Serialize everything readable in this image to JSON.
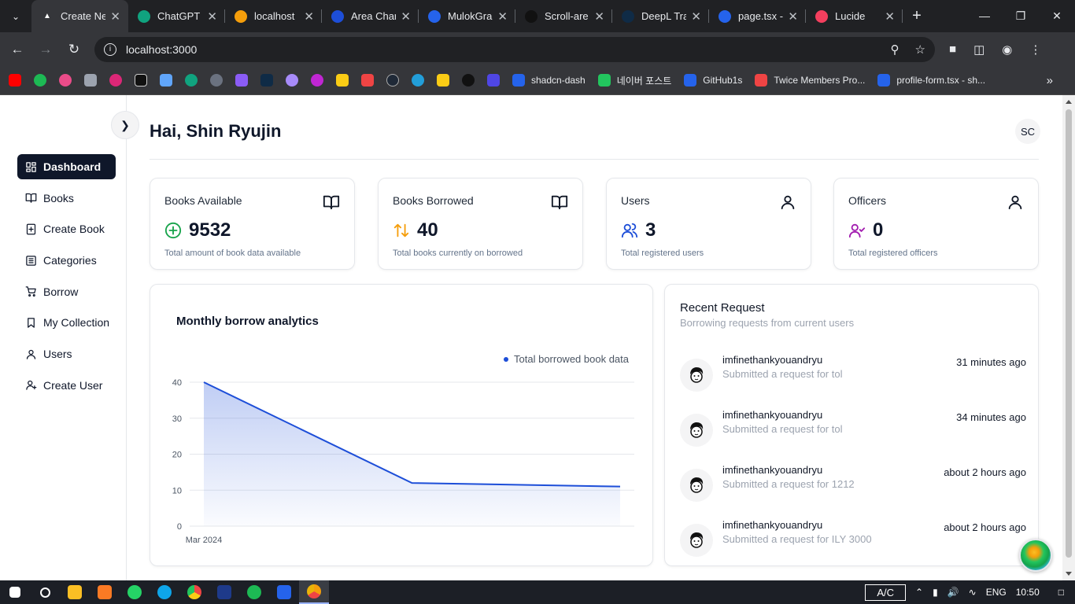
{
  "browser": {
    "tabs": [
      {
        "title": "Create Ne",
        "active": true,
        "color": "#ffffff"
      },
      {
        "title": "ChatGPT",
        "active": false,
        "color": "#10a37f"
      },
      {
        "title": "localhost",
        "active": false,
        "color": "#f59e0b"
      },
      {
        "title": "Area Char",
        "active": false,
        "color": "#1d4ed8"
      },
      {
        "title": "MulokGra",
        "active": false,
        "color": "#2563eb"
      },
      {
        "title": "Scroll-are",
        "active": false,
        "color": "#111111"
      },
      {
        "title": "DeepL Tra",
        "active": false,
        "color": "#0f2b46"
      },
      {
        "title": "page.tsx -",
        "active": false,
        "color": "#2563eb"
      },
      {
        "title": "Lucide",
        "active": false,
        "color": "#f43f5e"
      }
    ],
    "url": "localhost:3000",
    "bookmarks": [
      {
        "label": "shadcn-dash"
      },
      {
        "label": "네이버 포스트"
      },
      {
        "label": "GitHub1s"
      },
      {
        "label": "Twice Members Pro..."
      },
      {
        "label": "profile-form.tsx - sh..."
      }
    ]
  },
  "sidebar": {
    "items": [
      {
        "label": "Dashboard",
        "icon": "layout-dashboard-icon",
        "active": true
      },
      {
        "label": "Books",
        "icon": "book-open-icon",
        "active": false
      },
      {
        "label": "Create Book",
        "icon": "file-plus-icon",
        "active": false
      },
      {
        "label": "Categories",
        "icon": "list-icon",
        "active": false
      },
      {
        "label": "Borrow",
        "icon": "shopping-cart-icon",
        "active": false
      },
      {
        "label": "My Collection",
        "icon": "bookmark-icon",
        "active": false
      },
      {
        "label": "Users",
        "icon": "user-icon",
        "active": false
      },
      {
        "label": "Create User",
        "icon": "user-plus-icon",
        "active": false
      }
    ]
  },
  "header": {
    "greeting": "Hai, Shin Ryujin",
    "avatar_initials": "SC"
  },
  "stats": [
    {
      "title": "Books Available",
      "value": "9532",
      "desc": "Total amount of book data available",
      "value_icon": "circle-plus-icon",
      "value_icon_color": "#16a34a",
      "corner_icon": "book-open-icon"
    },
    {
      "title": "Books Borrowed",
      "value": "40",
      "desc": "Total books currently on borrowed",
      "value_icon": "arrow-up-down-icon",
      "value_icon_color": "#f59e0b",
      "corner_icon": "book-open-icon"
    },
    {
      "title": "Users",
      "value": "3",
      "desc": "Total registered users",
      "value_icon": "users-icon",
      "value_icon_color": "#1d4ed8",
      "corner_icon": "user-icon"
    },
    {
      "title": "Officers",
      "value": "0",
      "desc": "Total registered officers",
      "value_icon": "user-check-icon",
      "value_icon_color": "#a21caf",
      "corner_icon": "user-icon"
    }
  ],
  "chart_data": {
    "type": "area",
    "title": "Monthly borrow analytics",
    "xlabel": "",
    "ylabel": "",
    "x": [
      "Mar 2024",
      "",
      ""
    ],
    "x_tick_labels": [
      "Mar 2024"
    ],
    "series": [
      {
        "name": "Total borrowed book data",
        "values": [
          40,
          12,
          11
        ],
        "color": "#1d4ed8"
      }
    ],
    "y_ticks": [
      0,
      10,
      20,
      30,
      40
    ],
    "ylim": [
      0,
      40
    ],
    "grid": true,
    "legend": "top-right"
  },
  "recent": {
    "title": "Recent Request",
    "subtitle": "Borrowing requests from current users",
    "items": [
      {
        "user": "imfinethankyouandryu",
        "message": "Submitted a request for tol",
        "time": "31 minutes ago"
      },
      {
        "user": "imfinethankyouandryu",
        "message": "Submitted a request for tol",
        "time": "34 minutes ago"
      },
      {
        "user": "imfinethankyouandryu",
        "message": "Submitted a request for 1212",
        "time": "about 2 hours ago"
      },
      {
        "user": "imfinethankyouandryu",
        "message": "Submitted a request for ILY 3000",
        "time": "about 2 hours ago"
      }
    ]
  },
  "taskbar": {
    "ac_label": "A/C",
    "lang": "ENG",
    "time": "10:50"
  }
}
